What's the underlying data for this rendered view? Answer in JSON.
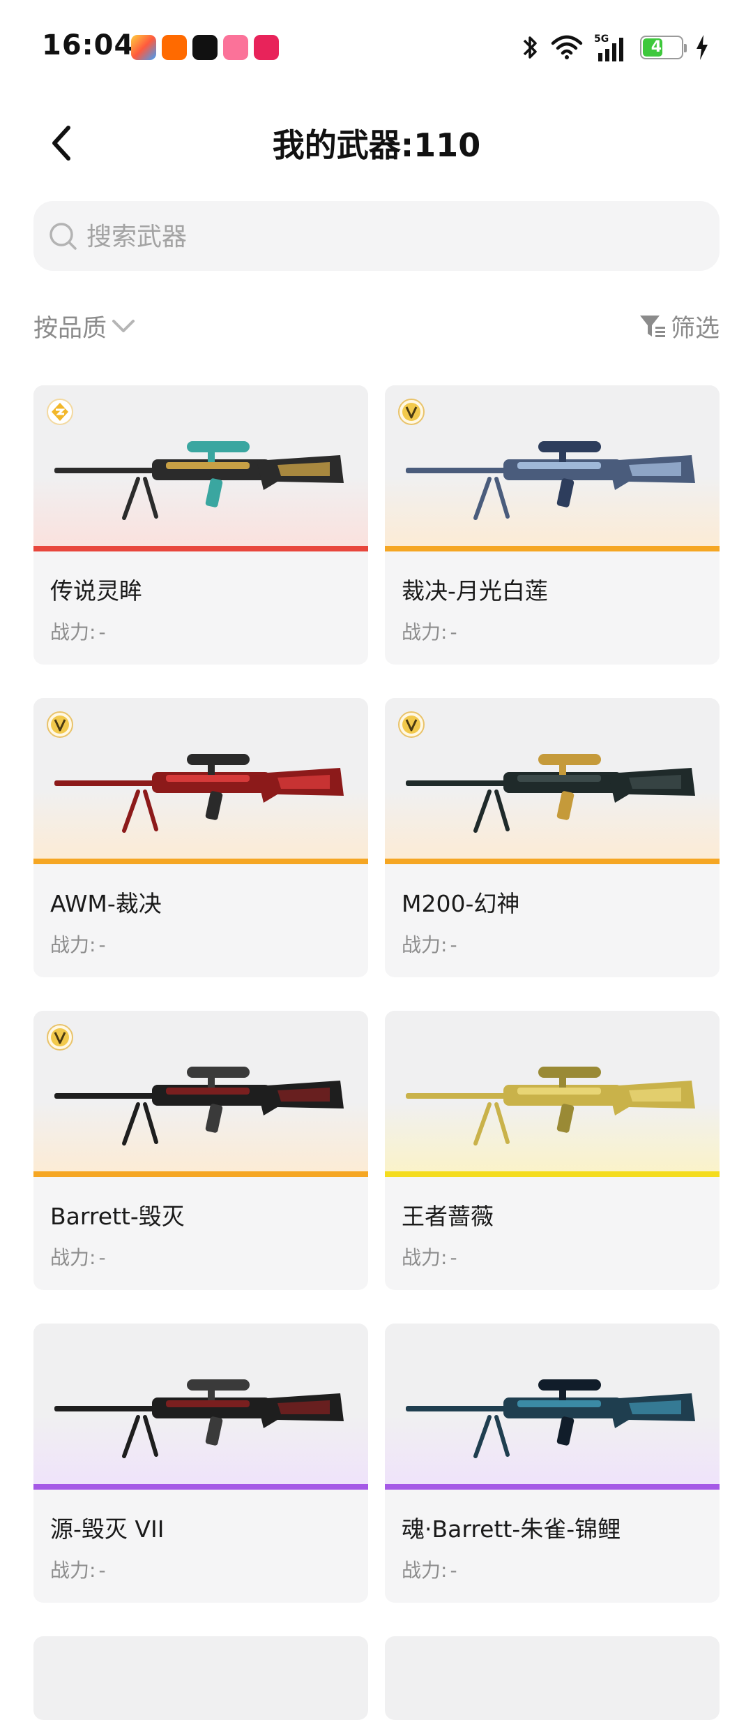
{
  "status_bar": {
    "time": "16:04",
    "battery": "47"
  },
  "header": {
    "title": "我的武器:110"
  },
  "search": {
    "placeholder": "搜索武器"
  },
  "toolbar": {
    "sort_label": "按品质",
    "filter_label": "筛选"
  },
  "colors": {
    "legend": "#e8463c",
    "orange": "#f5a623",
    "yellow": "#f4dc1e",
    "purple": "#a559e6"
  },
  "weapons": [
    {
      "name": "传说灵眸",
      "power_label": "战力:",
      "power_value": "-",
      "tier": "legend",
      "badge": "diamond-badge-icon"
    },
    {
      "name": "裁决-月光白莲",
      "power_label": "战力:",
      "power_value": "-",
      "tier": "orange",
      "badge": "v-badge-icon"
    },
    {
      "name": "AWM-裁决",
      "power_label": "战力:",
      "power_value": "-",
      "tier": "orange",
      "badge": "v-badge-icon"
    },
    {
      "name": "M200-幻神",
      "power_label": "战力:",
      "power_value": "-",
      "tier": "orange",
      "badge": "v-badge-icon"
    },
    {
      "name": "Barrett-毁灭",
      "power_label": "战力:",
      "power_value": "-",
      "tier": "orange",
      "badge": "v-badge-icon"
    },
    {
      "name": "王者蔷薇",
      "power_label": "战力:",
      "power_value": "-",
      "tier": "yellow",
      "badge": ""
    },
    {
      "name": "源-毁灭 VII",
      "power_label": "战力:",
      "power_value": "-",
      "tier": "purple",
      "badge": ""
    },
    {
      "name": "魂·Barrett-朱雀-锦鲤",
      "power_label": "战力:",
      "power_value": "-",
      "tier": "purple",
      "badge": ""
    }
  ]
}
